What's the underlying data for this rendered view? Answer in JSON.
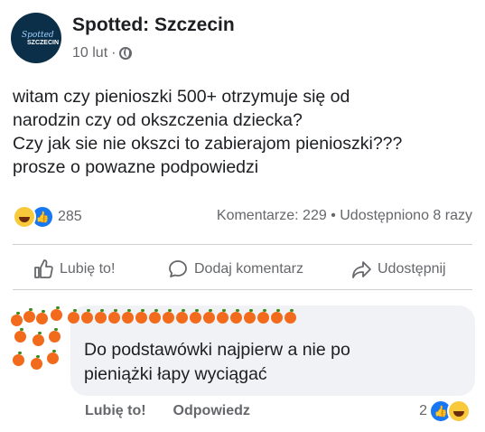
{
  "post": {
    "page_name": "Spotted: Szczecin",
    "avatar_text_1": "Spotted",
    "avatar_text_2": "SZCZECIN",
    "date": "10 lut",
    "separator": "·",
    "text_lines": [
      "witam czy pienioszki 500+ otrzymuje się od",
      "narodzin czy od okszczenia dziecka?",
      "Czy jak sie nie okszci to zabierajom pienioszki???",
      "prosze o powazne podpowiedzi"
    ],
    "reaction_count": "285",
    "stats": "Komentarze: 229 • Udostępniono 8 razy"
  },
  "actions": {
    "like": "Lubię to!",
    "comment": "Dodaj komentarz",
    "share": "Udostępnij"
  },
  "comment": {
    "text_lines": [
      "Do podstawówki najpierw a nie po",
      "pieniążki łapy wyciągać"
    ],
    "like_label": "Lubię to!",
    "reply_label": "Odpowiedz",
    "reaction_count": "2"
  },
  "colors": {
    "like_blue": "#1877f2",
    "haha_yellow": "#f7c93b",
    "orange": "#f26a1b",
    "bubble_gray": "#f0f2f5"
  },
  "icons": {
    "privacy": "globe-icon",
    "like": "thumbs-up-icon",
    "comment": "speech-bubble-icon",
    "share": "share-arrow-icon"
  }
}
